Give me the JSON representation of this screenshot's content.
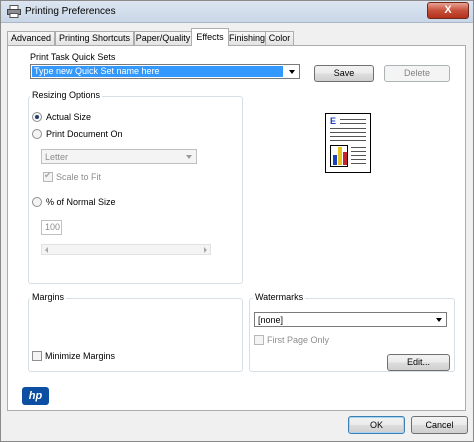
{
  "window": {
    "title": "Printing Preferences",
    "close_glyph": "X",
    "icon": "printer-icon"
  },
  "tabs": [
    {
      "label": "Advanced"
    },
    {
      "label": "Printing Shortcuts"
    },
    {
      "label": "Paper/Quality"
    },
    {
      "label": "Effects",
      "active": true
    },
    {
      "label": "Finishing"
    },
    {
      "label": "Color"
    }
  ],
  "quick_sets": {
    "label": "Print Task Quick Sets",
    "value": "Type new Quick Set name here",
    "save_label": "Save",
    "delete_label": "Delete"
  },
  "resizing": {
    "title": "Resizing Options",
    "actual_size_label": "Actual Size",
    "print_document_on_label": "Print Document On",
    "paper_value": "Letter",
    "scale_to_fit_label": "Scale to Fit",
    "percent_label": "% of Normal Size",
    "percent_value": "100",
    "selected": "Actual Size"
  },
  "margins": {
    "title": "Margins",
    "minimize_label": "Minimize Margins"
  },
  "watermarks": {
    "title": "Watermarks",
    "value": "[none]",
    "first_page_only_label": "First Page Only",
    "edit_label": "Edit..."
  },
  "preview": {
    "letter": "E",
    "bar_colors": [
      "#1a3fbf",
      "#e8c21a",
      "#c8232c"
    ]
  },
  "footer": {
    "logo_text": "hp",
    "ok_label": "OK",
    "cancel_label": "Cancel"
  },
  "colors": {
    "selection_blue": "#3399ff",
    "hp_blue": "#0b4ea2"
  }
}
